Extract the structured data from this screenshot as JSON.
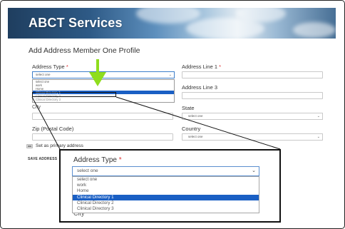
{
  "banner": {
    "title": "ABCT Services"
  },
  "page": {
    "heading": "Add Address Member One Profile"
  },
  "form": {
    "address_type": {
      "label": "Address Type",
      "required": "*",
      "value": "select one"
    },
    "address_line1": {
      "label": "Address Line 1",
      "required": "*"
    },
    "address_line3": {
      "label": "Address Line 3"
    },
    "city": {
      "label": "City"
    },
    "state": {
      "label": "State",
      "value": "select one"
    },
    "zip": {
      "label": "Zip (Postal Code)"
    },
    "country": {
      "label": "Country",
      "value": "select one"
    },
    "primary_checkbox": {
      "label": "Set as primary address"
    },
    "save_button": "SAVE ADDRESS"
  },
  "address_type_options": [
    "select one",
    "work",
    "Home",
    "Clinical Directory 1",
    "Clinical Directory 2",
    "Clinical Directory 3"
  ],
  "selected_option": "Clinical Directory 1",
  "colors": {
    "highlight": "#1a5fc4",
    "arrow": "#8fdd1d",
    "required": "#d33333"
  },
  "icons": {
    "arrow": "green-down-arrow-icon",
    "chevron": "chevron-down-icon"
  }
}
